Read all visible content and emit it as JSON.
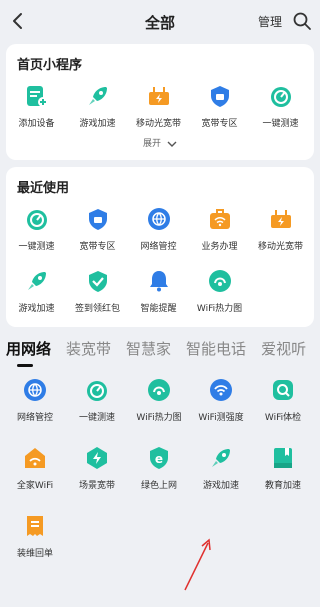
{
  "header": {
    "title": "全部",
    "manage": "管理"
  },
  "homepage": {
    "title": "首页小程序",
    "items": [
      {
        "label": "添加设备",
        "icon": "add-device-icon"
      },
      {
        "label": "游戏加速",
        "icon": "rocket-icon"
      },
      {
        "label": "移动光宽带",
        "icon": "router-icon"
      },
      {
        "label": "宽带专区",
        "icon": "broadband-shield-icon"
      },
      {
        "label": "一键测速",
        "icon": "speedometer-icon"
      }
    ],
    "expand": "展开"
  },
  "recent": {
    "title": "最近使用",
    "items": [
      {
        "label": "一键测速",
        "icon": "speedometer-icon"
      },
      {
        "label": "宽带专区",
        "icon": "broadband-shield-icon"
      },
      {
        "label": "网络管控",
        "icon": "globe-icon"
      },
      {
        "label": "业务办理",
        "icon": "briefcase-wifi-icon"
      },
      {
        "label": "移动光宽带",
        "icon": "router-icon"
      },
      {
        "label": "游戏加速",
        "icon": "rocket-icon"
      },
      {
        "label": "签到领红包",
        "icon": "check-shield-icon"
      },
      {
        "label": "智能提醒",
        "icon": "bell-icon"
      },
      {
        "label": "WiFi热力图",
        "icon": "wifi-heatmap-icon"
      }
    ]
  },
  "tabs": [
    "用网络",
    "装宽带",
    "智慧家",
    "智能电话",
    "爱视听"
  ],
  "network": {
    "items": [
      {
        "label": "网络管控",
        "icon": "globe-icon"
      },
      {
        "label": "一键测速",
        "icon": "speedometer-icon"
      },
      {
        "label": "WiFi热力图",
        "icon": "wifi-heatmap-icon"
      },
      {
        "label": "WiFi测强度",
        "icon": "wifi-strength-icon"
      },
      {
        "label": "WiFi体检",
        "icon": "wifi-check-icon"
      },
      {
        "label": "全家WiFi",
        "icon": "home-wifi-icon"
      },
      {
        "label": "场景宽带",
        "icon": "lightning-icon"
      },
      {
        "label": "绿色上网",
        "icon": "green-e-icon"
      },
      {
        "label": "游戏加速",
        "icon": "rocket-icon"
      },
      {
        "label": "教育加速",
        "icon": "book-icon"
      },
      {
        "label": "装维回单",
        "icon": "receipt-icon"
      }
    ]
  },
  "colors": {
    "teal": "#1fbf9f",
    "blue": "#2f7de6",
    "orange": "#f59a23",
    "page_bg": "#eef0f4",
    "arrow": "#e0312f"
  }
}
